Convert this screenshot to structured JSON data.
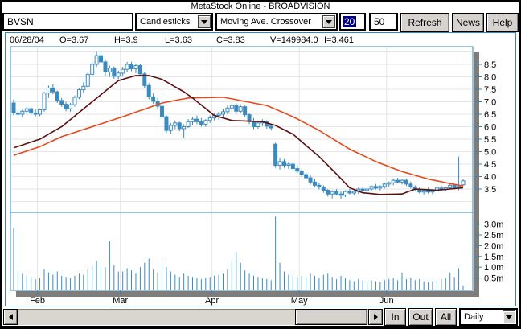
{
  "window": {
    "title": "MetaStock Online - BROADVISION"
  },
  "toolbar": {
    "symbol": "BVSN",
    "chart_type": {
      "value": "Candlesticks"
    },
    "indicator": {
      "value": "Moving Ave. Crossover"
    },
    "ma_fast": "20",
    "ma_slow": "50",
    "refresh_label": "Refresh",
    "news_label": "News",
    "help_label": "Help"
  },
  "status_bar": {
    "date": "06/28/04",
    "open": "O=3.67",
    "high": "H=3.9",
    "low": "L=3.63",
    "close": "C=3.83",
    "volume": "V=149984.0",
    "indicator": "I=3.461"
  },
  "footer": {
    "zoom_in": "In",
    "zoom_out": "Out",
    "zoom_all": "All",
    "period": {
      "value": "Daily"
    }
  },
  "chart_data": {
    "type": "candlestick+volume",
    "symbol": "BVSN",
    "price_ticks": [
      8.5,
      8.0,
      7.5,
      7.0,
      6.5,
      6.0,
      5.5,
      5.0,
      4.5,
      4.0,
      3.5
    ],
    "price_ylim": [
      2.6,
      9.2
    ],
    "volume_ticks": [
      "3.0m",
      "2.5m",
      "2.0m",
      "1.5m",
      "1.0m",
      "0.5m"
    ],
    "months": [
      "Feb",
      "Mar",
      "Apr",
      "May",
      "Jun"
    ],
    "month_start_index": [
      6,
      25,
      46,
      66,
      86
    ],
    "colors": {
      "candle": "#3a8ac0",
      "ma20": "#5e0e0e",
      "ma50": "#e8481a",
      "grid": "#e5e5e5",
      "border": "#3584bb",
      "shadow": "#7d7d7d",
      "selection": "#000080"
    },
    "legend": {
      "ma_fast_period": 20,
      "ma_slow_period": 50
    },
    "candles_note": "each row = [open, high, low, close, volume_millions]",
    "candles": [
      [
        6.95,
        7.1,
        6.45,
        6.55,
        2.8
      ],
      [
        6.55,
        6.75,
        6.35,
        6.5,
        0.85
      ],
      [
        6.5,
        6.68,
        6.38,
        6.62,
        0.7
      ],
      [
        6.62,
        6.8,
        6.5,
        6.72,
        0.6
      ],
      [
        6.72,
        6.78,
        6.48,
        6.55,
        0.55
      ],
      [
        6.55,
        6.7,
        6.4,
        6.5,
        0.45
      ],
      [
        6.5,
        6.72,
        6.42,
        6.68,
        0.5
      ],
      [
        6.68,
        7.4,
        6.6,
        7.35,
        0.9
      ],
      [
        7.35,
        7.65,
        7.15,
        7.55,
        0.75
      ],
      [
        7.55,
        7.7,
        7.3,
        7.4,
        0.65
      ],
      [
        7.4,
        7.45,
        6.95,
        7.05,
        0.8
      ],
      [
        7.05,
        7.15,
        6.8,
        6.9,
        0.6
      ],
      [
        6.9,
        7.0,
        6.62,
        6.72,
        0.55
      ],
      [
        6.72,
        6.95,
        6.6,
        6.88,
        0.5
      ],
      [
        6.88,
        7.25,
        6.8,
        7.18,
        0.6
      ],
      [
        7.18,
        7.55,
        7.1,
        7.48,
        0.7
      ],
      [
        7.48,
        7.78,
        7.35,
        7.62,
        0.65
      ],
      [
        7.62,
        8.2,
        7.52,
        8.1,
        0.9
      ],
      [
        8.1,
        8.6,
        8.0,
        8.5,
        1.1
      ],
      [
        8.5,
        9.0,
        8.4,
        8.85,
        1.3
      ],
      [
        8.85,
        9.0,
        8.5,
        8.6,
        1.0
      ],
      [
        8.6,
        8.7,
        8.05,
        8.2,
        1.0
      ],
      [
        8.2,
        8.45,
        8.0,
        8.35,
        2.2
      ],
      [
        8.35,
        8.42,
        7.92,
        8.02,
        1.1
      ],
      [
        8.02,
        8.25,
        7.9,
        8.15,
        0.8
      ],
      [
        8.15,
        8.4,
        8.02,
        8.3,
        0.8
      ],
      [
        8.3,
        8.6,
        8.2,
        8.5,
        0.95
      ],
      [
        8.5,
        8.6,
        8.22,
        8.32,
        0.85
      ],
      [
        8.32,
        8.52,
        8.15,
        8.45,
        0.7
      ],
      [
        8.45,
        8.5,
        8.02,
        8.12,
        1.0
      ],
      [
        8.12,
        8.2,
        7.55,
        7.65,
        1.2
      ],
      [
        7.65,
        7.75,
        7.1,
        7.2,
        1.4
      ],
      [
        7.2,
        7.35,
        6.92,
        7.02,
        0.9
      ],
      [
        7.02,
        7.15,
        6.72,
        6.82,
        0.75
      ],
      [
        6.82,
        6.9,
        6.3,
        6.4,
        1.2
      ],
      [
        6.4,
        6.45,
        5.75,
        5.85,
        1.0
      ],
      [
        5.85,
        6.15,
        5.7,
        6.05,
        0.8
      ],
      [
        6.05,
        6.25,
        5.9,
        6.15,
        0.65
      ],
      [
        6.15,
        6.2,
        5.82,
        5.92,
        0.55
      ],
      [
        5.92,
        6.1,
        5.55,
        6.0,
        0.7
      ],
      [
        6.0,
        6.3,
        5.95,
        6.2,
        0.6
      ],
      [
        6.2,
        6.4,
        6.05,
        6.3,
        0.55
      ],
      [
        6.3,
        6.45,
        6.1,
        6.2,
        0.5
      ],
      [
        6.2,
        6.35,
        6.0,
        6.1,
        0.45
      ],
      [
        6.1,
        6.3,
        6.0,
        6.25,
        0.5
      ],
      [
        6.25,
        6.45,
        6.15,
        6.35,
        0.55
      ],
      [
        6.35,
        6.55,
        6.25,
        6.45,
        0.6
      ],
      [
        6.45,
        6.6,
        6.28,
        6.5,
        0.65
      ],
      [
        6.5,
        6.7,
        6.4,
        6.6,
        0.7
      ],
      [
        6.6,
        6.85,
        6.5,
        6.75,
        0.9
      ],
      [
        6.75,
        6.95,
        6.6,
        6.85,
        1.3
      ],
      [
        6.85,
        6.95,
        6.52,
        6.62,
        1.7
      ],
      [
        6.62,
        6.9,
        6.55,
        6.8,
        1.2
      ],
      [
        6.8,
        6.85,
        6.38,
        6.48,
        0.85
      ],
      [
        6.48,
        6.55,
        6.1,
        6.2,
        0.7
      ],
      [
        6.2,
        6.35,
        5.9,
        6.0,
        0.6
      ],
      [
        6.0,
        6.25,
        5.92,
        6.15,
        0.55
      ],
      [
        6.15,
        6.3,
        6.02,
        6.2,
        0.5
      ],
      [
        6.2,
        6.25,
        5.92,
        6.02,
        0.45
      ],
      [
        6.02,
        6.1,
        5.85,
        5.95,
        0.4
      ],
      [
        5.3,
        5.35,
        4.35,
        4.45,
        3.35
      ],
      [
        4.45,
        4.75,
        4.28,
        4.6,
        1.2
      ],
      [
        4.6,
        4.7,
        4.35,
        4.45,
        0.8
      ],
      [
        4.45,
        4.6,
        4.3,
        4.5,
        0.65
      ],
      [
        4.5,
        4.55,
        4.22,
        4.32,
        0.6
      ],
      [
        4.32,
        4.45,
        4.12,
        4.22,
        0.55
      ],
      [
        4.22,
        4.3,
        3.98,
        4.08,
        0.6
      ],
      [
        4.08,
        4.18,
        3.88,
        3.95,
        0.55
      ],
      [
        3.95,
        4.05,
        3.68,
        3.78,
        0.7
      ],
      [
        3.78,
        3.9,
        3.58,
        3.65,
        0.6
      ],
      [
        3.65,
        3.75,
        3.48,
        3.58,
        0.5
      ],
      [
        3.58,
        3.65,
        3.35,
        3.45,
        0.65
      ],
      [
        3.45,
        3.5,
        3.2,
        3.3,
        0.7
      ],
      [
        3.3,
        3.45,
        3.12,
        3.4,
        0.55
      ],
      [
        3.4,
        3.5,
        3.25,
        3.3,
        0.45
      ],
      [
        3.3,
        3.4,
        3.08,
        3.25,
        0.6
      ],
      [
        3.25,
        3.45,
        3.18,
        3.4,
        0.5
      ],
      [
        3.4,
        3.5,
        3.28,
        3.34,
        0.4
      ],
      [
        3.34,
        3.45,
        3.24,
        3.4,
        0.35
      ],
      [
        3.4,
        3.55,
        3.3,
        3.5,
        0.45
      ],
      [
        3.5,
        3.6,
        3.38,
        3.44,
        0.4
      ],
      [
        3.44,
        3.55,
        3.34,
        3.5,
        0.35
      ],
      [
        3.5,
        3.65,
        3.44,
        3.6,
        0.4
      ],
      [
        3.6,
        3.7,
        3.48,
        3.54,
        0.35
      ],
      [
        3.54,
        3.65,
        3.44,
        3.6,
        0.3
      ],
      [
        3.6,
        3.75,
        3.52,
        3.7,
        0.4
      ],
      [
        3.7,
        3.8,
        3.6,
        3.75,
        0.45
      ],
      [
        3.75,
        3.9,
        3.65,
        3.85,
        0.5
      ],
      [
        3.85,
        3.95,
        3.72,
        3.78,
        0.4
      ],
      [
        3.78,
        3.9,
        3.68,
        3.85,
        0.75
      ],
      [
        3.85,
        3.92,
        3.62,
        3.7,
        0.45
      ],
      [
        3.7,
        3.8,
        3.52,
        3.58,
        0.5
      ],
      [
        3.58,
        3.65,
        3.42,
        3.48,
        0.4
      ],
      [
        3.48,
        3.58,
        3.32,
        3.38,
        0.45
      ],
      [
        3.38,
        3.5,
        3.28,
        3.44,
        0.35
      ],
      [
        3.44,
        3.55,
        3.32,
        3.38,
        0.3
      ],
      [
        3.38,
        3.5,
        3.28,
        3.44,
        0.35
      ],
      [
        3.44,
        3.6,
        3.38,
        3.54,
        0.4
      ],
      [
        3.54,
        3.65,
        3.42,
        3.48,
        0.45
      ],
      [
        3.48,
        3.6,
        3.4,
        3.55,
        0.5
      ],
      [
        3.55,
        3.7,
        3.48,
        3.65,
        0.75
      ],
      [
        3.65,
        3.7,
        3.48,
        3.54,
        0.55
      ],
      [
        3.54,
        4.8,
        3.45,
        3.6,
        0.95
      ],
      [
        3.67,
        3.9,
        3.63,
        3.83,
        0.15
      ]
    ],
    "ma20_points": [
      [
        0,
        5.15
      ],
      [
        6,
        5.5
      ],
      [
        11,
        6.0
      ],
      [
        18,
        7.0
      ],
      [
        24,
        7.85
      ],
      [
        28,
        8.05
      ],
      [
        31,
        8.05
      ],
      [
        34,
        7.9
      ],
      [
        39,
        7.4
      ],
      [
        41,
        7.15
      ],
      [
        46,
        6.45
      ],
      [
        50,
        6.25
      ],
      [
        57,
        6.2
      ],
      [
        60,
        6.05
      ],
      [
        64,
        5.7
      ],
      [
        70,
        4.8
      ],
      [
        74,
        4.1
      ],
      [
        77,
        3.55
      ],
      [
        80,
        3.35
      ],
      [
        84,
        3.28
      ],
      [
        89,
        3.3
      ],
      [
        92,
        3.5
      ],
      [
        97,
        3.45
      ],
      [
        100,
        3.5
      ],
      [
        103,
        3.55
      ]
    ],
    "ma50_points": [
      [
        0,
        4.85
      ],
      [
        6,
        5.2
      ],
      [
        11,
        5.6
      ],
      [
        18,
        6.0
      ],
      [
        25,
        6.4
      ],
      [
        34,
        6.95
      ],
      [
        40,
        7.15
      ],
      [
        48,
        7.18
      ],
      [
        52,
        7.05
      ],
      [
        58,
        6.85
      ],
      [
        64,
        6.4
      ],
      [
        70,
        5.85
      ],
      [
        77,
        5.1
      ],
      [
        83,
        4.6
      ],
      [
        89,
        4.2
      ],
      [
        95,
        3.9
      ],
      [
        100,
        3.72
      ],
      [
        103,
        3.62
      ]
    ]
  }
}
